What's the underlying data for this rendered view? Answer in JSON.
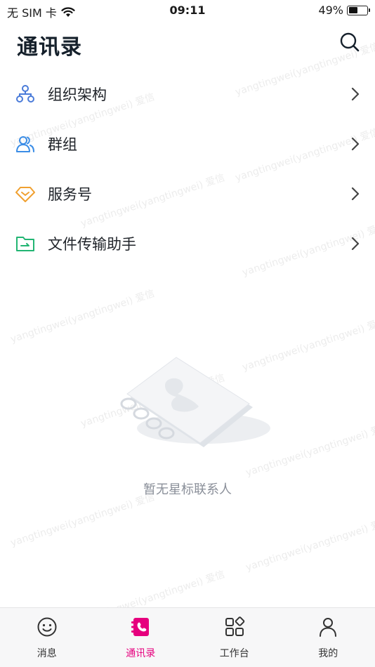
{
  "status_bar": {
    "carrier": "无 SIM 卡",
    "time": "09:11",
    "battery_percent_text": "49%",
    "battery_level": 0.49
  },
  "header": {
    "title": "通讯录",
    "search_icon": "search-icon"
  },
  "menu": [
    {
      "label": "组织架构",
      "icon": "org-chart-icon",
      "color": "#4a7bd9"
    },
    {
      "label": "群组",
      "icon": "group-icon",
      "color": "#3b8de6"
    },
    {
      "label": "服务号",
      "icon": "service-diamond-icon",
      "color": "#f0a030"
    },
    {
      "label": "文件传输助手",
      "icon": "folder-transfer-icon",
      "color": "#22b573"
    }
  ],
  "empty_state": {
    "text": "暂无星标联系人"
  },
  "watermark": "yangtingwei(yangtingwei) 爱信",
  "tabs": [
    {
      "label": "消息",
      "icon": "message-smile-icon",
      "active": false
    },
    {
      "label": "通讯录",
      "icon": "contacts-book-icon",
      "active": true
    },
    {
      "label": "工作台",
      "icon": "workbench-grid-icon",
      "active": false
    },
    {
      "label": "我的",
      "icon": "profile-icon",
      "active": false
    }
  ],
  "colors": {
    "accent": "#e6007e",
    "title": "#15202b",
    "muted_text": "#8a8f99"
  }
}
